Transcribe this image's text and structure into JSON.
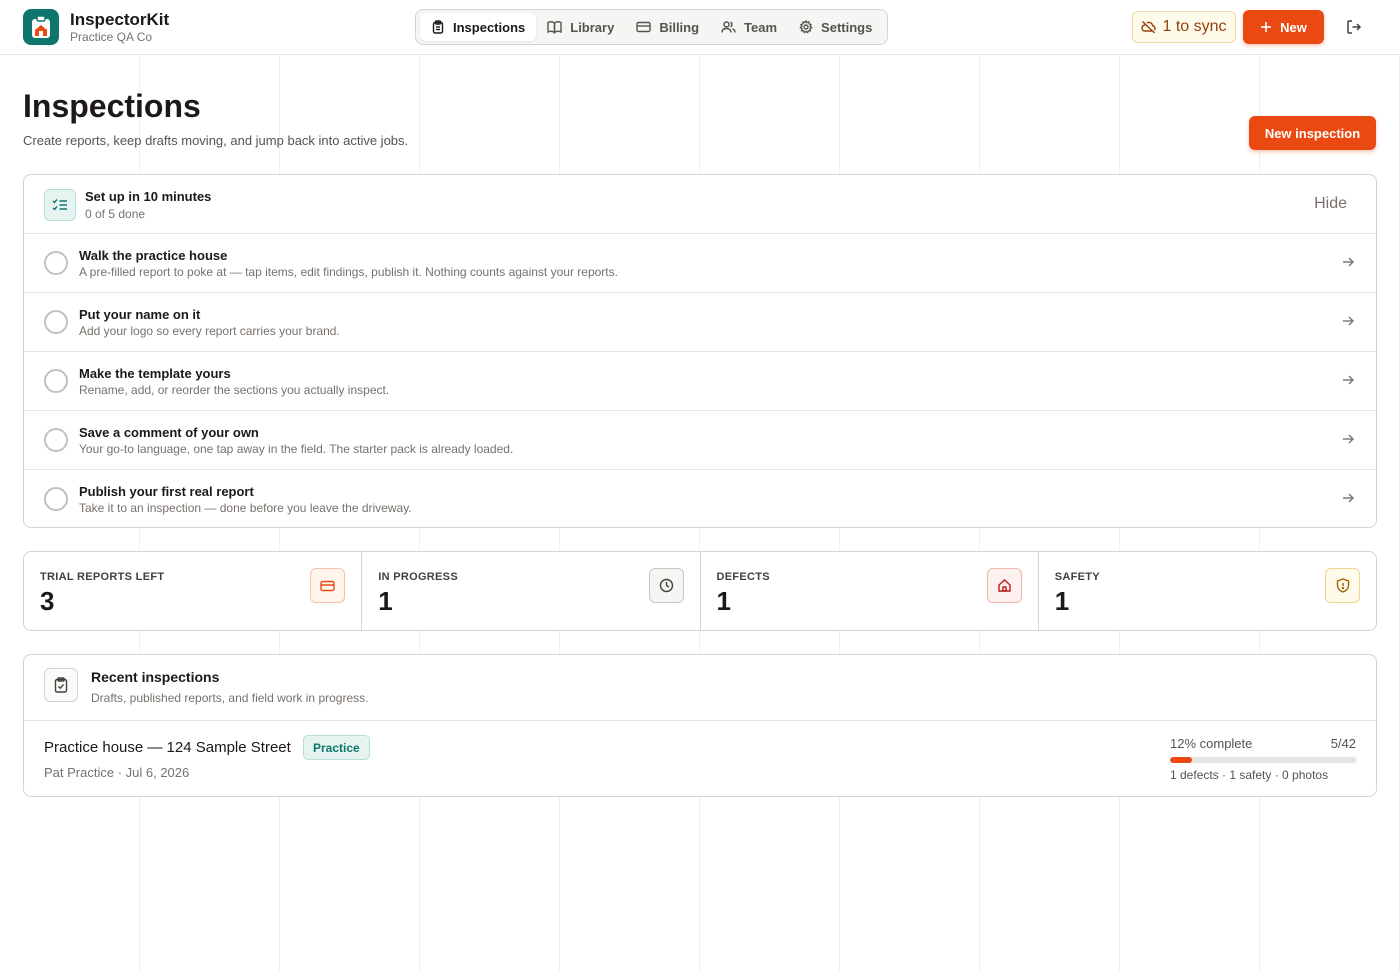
{
  "header": {
    "brand_name": "InspectorKit",
    "org_name": "Practice QA Co",
    "nav": [
      {
        "label": "Inspections",
        "icon": "clipboard-icon",
        "active": true
      },
      {
        "label": "Library",
        "icon": "book-icon",
        "active": false
      },
      {
        "label": "Billing",
        "icon": "credit-card-icon",
        "active": false
      },
      {
        "label": "Team",
        "icon": "users-icon",
        "active": false
      },
      {
        "label": "Settings",
        "icon": "gear-icon",
        "active": false
      }
    ],
    "sync_label": "1 to sync",
    "new_label": "New"
  },
  "page": {
    "title": "Inspections",
    "subtitle": "Create reports, keep drafts moving, and jump back into active jobs.",
    "new_inspection_label": "New inspection"
  },
  "setup": {
    "title": "Set up in 10 minutes",
    "progress": "0 of 5 done",
    "hide_label": "Hide",
    "steps": [
      {
        "title": "Walk the practice house",
        "desc": "A pre-filled report to poke at — tap items, edit findings, publish it. Nothing counts against your reports."
      },
      {
        "title": "Put your name on it",
        "desc": "Add your logo so every report carries your brand."
      },
      {
        "title": "Make the template yours",
        "desc": "Rename, add, or reorder the sections you actually inspect."
      },
      {
        "title": "Save a comment of your own",
        "desc": "Your go-to language, one tap away in the field. The starter pack is already loaded."
      },
      {
        "title": "Publish your first real report",
        "desc": "Take it to an inspection — done before you leave the driveway."
      }
    ]
  },
  "stats": [
    {
      "label": "TRIAL REPORTS LEFT",
      "value": "3",
      "icon": "credit-card-icon"
    },
    {
      "label": "IN PROGRESS",
      "value": "1",
      "icon": "clock-icon"
    },
    {
      "label": "DEFECTS",
      "value": "1",
      "icon": "home-icon"
    },
    {
      "label": "SAFETY",
      "value": "1",
      "icon": "shield-icon"
    }
  ],
  "recent": {
    "title": "Recent inspections",
    "subtitle": "Drafts, published reports, and field work in progress.",
    "items": [
      {
        "title": "Practice house — 124 Sample Street",
        "badge": "Practice",
        "meta": "Pat Practice · Jul 6, 2026",
        "progress_label": "12% complete",
        "progress_count": "5/42",
        "progress": 0.12,
        "stats": "1 defects · 1 safety · 0 photos"
      }
    ]
  },
  "colors": {
    "accent": "#ea4a12",
    "brand": "#0f766e"
  }
}
